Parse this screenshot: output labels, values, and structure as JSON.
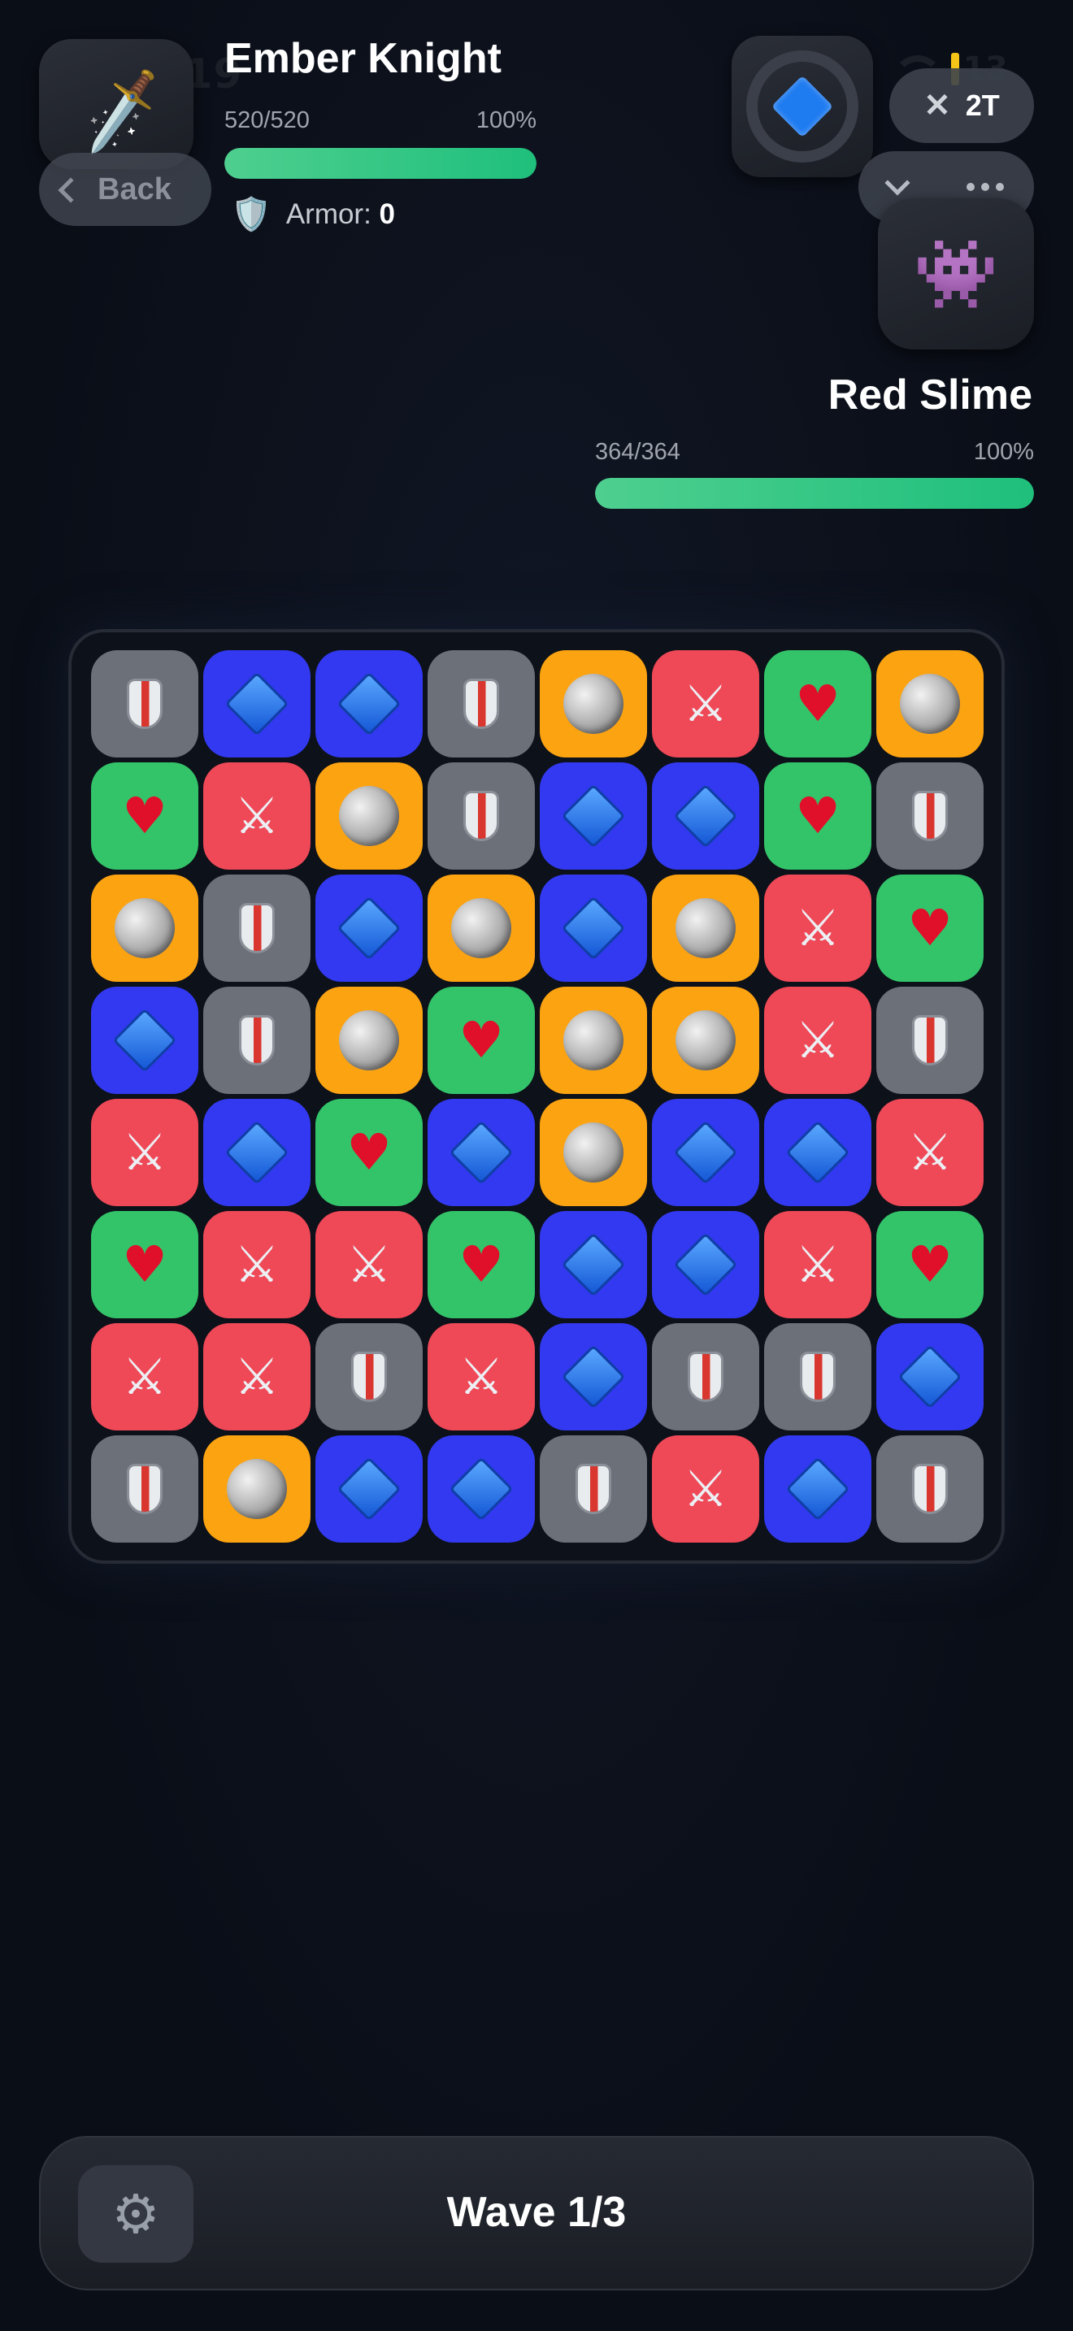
{
  "status_bar": {
    "time": "1:19",
    "battery": "13"
  },
  "player": {
    "name": "Ember Knight",
    "hp_text": "520/520",
    "hp_percent_text": "100%",
    "hp_fraction": 1.0,
    "armor_label": "Armor:",
    "armor_value": "0"
  },
  "nav": {
    "back_label": "Back"
  },
  "turns": {
    "label": "2T"
  },
  "enemy": {
    "name": "Red Slime",
    "hp_text": "364/364",
    "hp_percent_text": "100%",
    "hp_fraction": 1.0
  },
  "colors": {
    "shield": "#6b7079",
    "diamond": "#3239f0",
    "coin": "#fca311",
    "swords": "#ef4857",
    "heart": "#33c46a"
  },
  "board": {
    "rows": [
      [
        "shield",
        "diamond",
        "diamond",
        "shield",
        "coin",
        "swords",
        "heart",
        "coin"
      ],
      [
        "heart",
        "swords",
        "coin",
        "shield",
        "diamond",
        "diamond",
        "heart",
        "shield"
      ],
      [
        "coin",
        "shield",
        "diamond",
        "coin",
        "diamond",
        "coin",
        "swords",
        "heart"
      ],
      [
        "diamond",
        "shield",
        "coin",
        "heart",
        "coin",
        "coin",
        "swords",
        "shield"
      ],
      [
        "swords",
        "diamond",
        "heart",
        "diamond",
        "coin",
        "diamond",
        "diamond",
        "swords"
      ],
      [
        "heart",
        "swords",
        "swords",
        "heart",
        "diamond",
        "diamond",
        "swords",
        "heart"
      ],
      [
        "swords",
        "swords",
        "shield",
        "swords",
        "diamond",
        "shield",
        "shield",
        "diamond"
      ],
      [
        "shield",
        "coin",
        "diamond",
        "diamond",
        "shield",
        "swords",
        "diamond",
        "shield"
      ]
    ]
  },
  "footer": {
    "wave_label": "Wave 1/3"
  }
}
